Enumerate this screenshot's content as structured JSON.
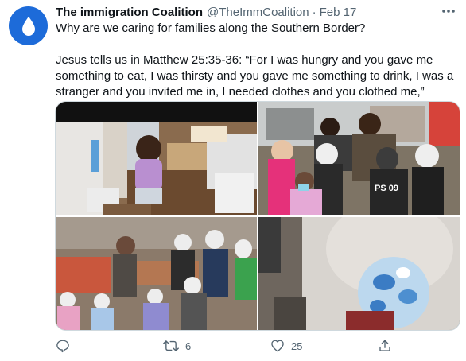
{
  "tweet": {
    "author_name": "The immigration Coalition",
    "handle": "@TheImmCoalition",
    "separator": "·",
    "date": "Feb 17",
    "line1": "Why are we caring for families along the Southern Border?",
    "line2": "Jesus tells us in Matthew 25:35-36: “For I was hungry and you gave me something to eat, I was thirsty and you gave me something to drink, I was a stranger and you invited me in, I needed clothes and you clothed me,”"
  },
  "photos": [
    {
      "name": "photo-child-unpacking-donations",
      "sweater_text": ""
    },
    {
      "name": "photo-group-of-children-outdoors",
      "sweater_text": "PS 09"
    },
    {
      "name": "photo-families-in-dirt-yard"
    },
    {
      "name": "photo-child-in-blue-hood-closeup"
    }
  ],
  "actions": {
    "reply": {
      "icon": "reply-icon",
      "count": ""
    },
    "retweet": {
      "icon": "retweet-icon",
      "count": "6"
    },
    "like": {
      "icon": "heart-icon",
      "count": "25"
    },
    "share": {
      "icon": "share-icon"
    }
  },
  "colors": {
    "accent": "#1d9bf0",
    "avatar_bg": "#1d6bd9",
    "secondary_text": "#536471",
    "border": "#cfd9de"
  }
}
